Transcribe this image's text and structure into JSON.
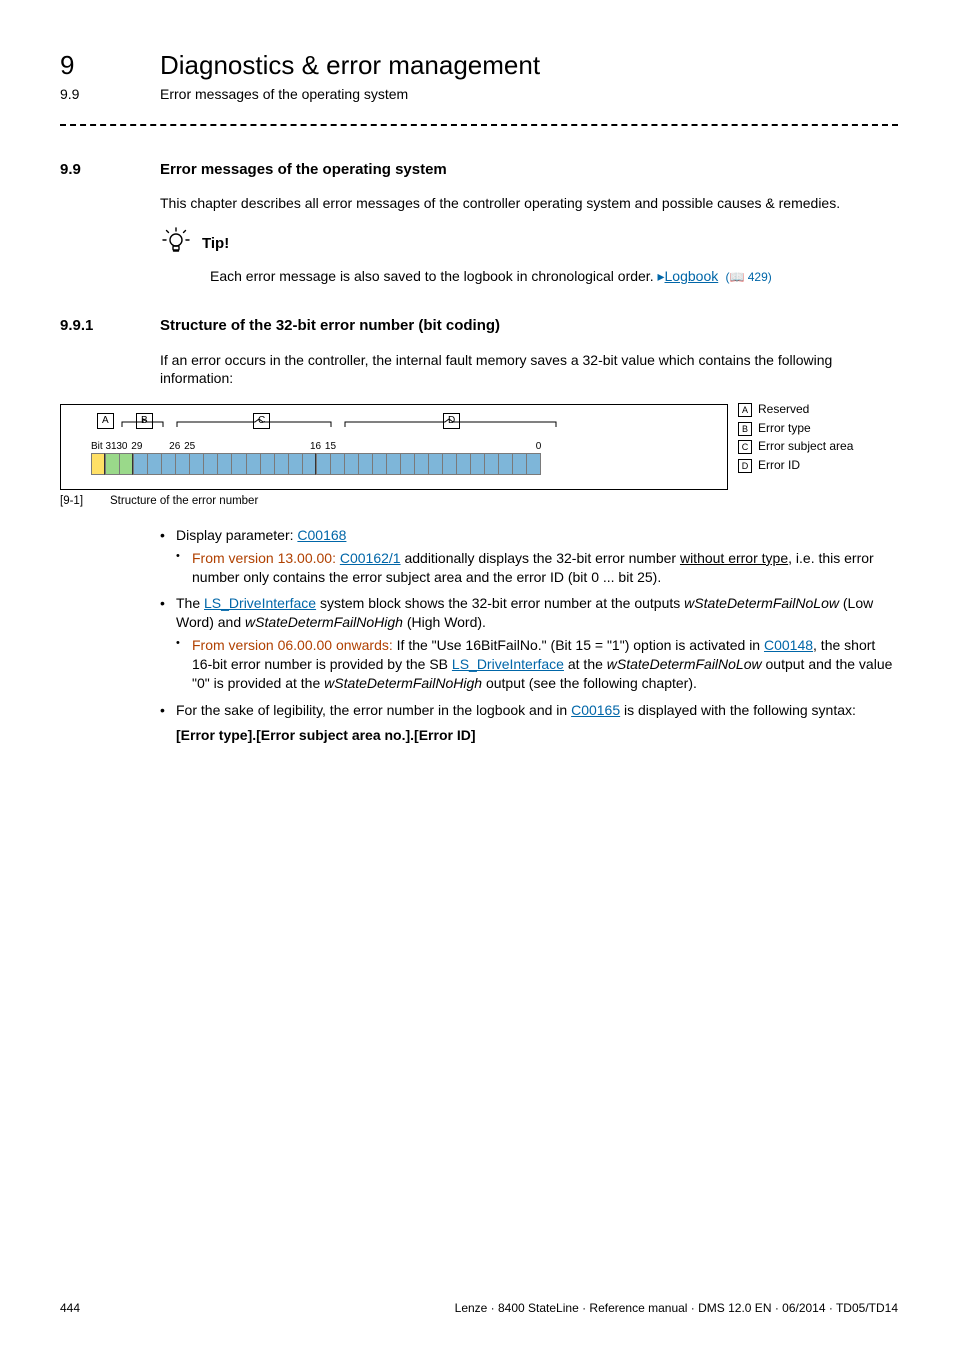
{
  "header": {
    "chapter_num": "9",
    "chapter_title": "Diagnostics & error management",
    "subchap_num": "9.9",
    "subchap_title": "Error messages of the operating system"
  },
  "s99": {
    "num": "9.9",
    "title": "Error messages of the operating system",
    "para": "This chapter describes all error messages of the controller operating system and possible causes & remedies.",
    "tip_label": "Tip!",
    "tip_body_pre": "Each error message is also saved to the logbook in chronological order.  ",
    "tip_link": "Logbook",
    "tip_pageref": "( 429)"
  },
  "s991": {
    "num": "9.9.1",
    "title": "Structure of the 32-bit error number (bit coding)",
    "para": "If an error occurs in the controller, the internal fault memory saves a 32-bit value which contains the following information:",
    "fig": {
      "bits": [
        "Bit 31",
        "30",
        "29",
        "26",
        "25",
        "16",
        "15",
        "0"
      ],
      "labels": {
        "A": "A",
        "B": "B",
        "C": "C",
        "D": "D"
      },
      "legend": {
        "A": "Reserved",
        "B": "Error type",
        "C": "Error subject area",
        "D": "Error ID"
      },
      "caption_num": "[9-1]",
      "caption_text": "Structure of the error number"
    },
    "bul1_pre": "Display parameter: ",
    "bul1_link": "C00168",
    "bul1_sub_ver": "From version 13.00.00:",
    "bul1_sub_link": "C00162/1",
    "bul1_sub_post1": " additionally displays the 32-bit error number ",
    "bul1_sub_ul": "without error type",
    "bul1_sub_post2": ", i.e. this error number only contains the error subject area and the error ID (bit 0 ... bit 25).",
    "bul2_pre": "The ",
    "bul2_link": "LS_DriveInterface",
    "bul2_mid": " system block shows the 32-bit error number at the outputs ",
    "bul2_i1": "wStateDetermFailNoLow",
    "bul2_mid2": " (Low Word) and ",
    "bul2_i2": "wStateDetermFailNoHigh",
    "bul2_post": " (High Word).",
    "bul2_sub_ver": "From version 06.00.00 onwards:",
    "bul2_sub_post1": " If the \"Use 16BitFailNo.\" (Bit 15 = \"1\") option is activated in ",
    "bul2_sub_link1": "C00148",
    "bul2_sub_post2": ", the short 16-bit error number is provided by the SB ",
    "bul2_sub_link2": "LS_DriveInterface",
    "bul2_sub_post3": " at the ",
    "bul2_sub_i1": "wStateDetermFailNoLow",
    "bul2_sub_post4": " output and the value \"0\" is provided at the ",
    "bul2_sub_i2": "wStateDetermFailNoHigh",
    "bul2_sub_post5": " output (see the following chapter).",
    "bul3_pre": "For the sake of legibility, the error number in the logbook and in ",
    "bul3_link": "C00165",
    "bul3_post": " is displayed with the following syntax:",
    "bul3_syntax": "[Error type].[Error subject area no.].[Error ID]"
  },
  "footer": {
    "page": "444",
    "right": "Lenze · 8400 StateLine · Reference manual · DMS 12.0 EN · 06/2014 · TD05/TD14"
  }
}
